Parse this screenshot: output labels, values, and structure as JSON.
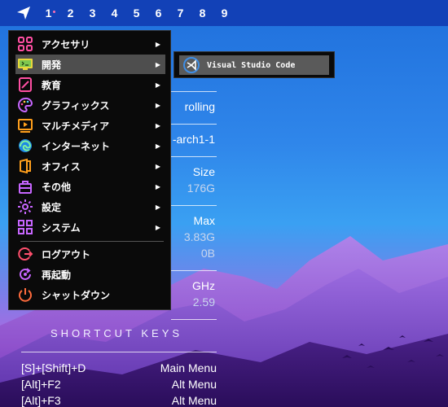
{
  "topbar": {
    "workspaces": [
      "1",
      "2",
      "3",
      "4",
      "5",
      "6",
      "7",
      "8",
      "9"
    ],
    "active_workspace": "1"
  },
  "menu": {
    "items": [
      {
        "label": "アクセサリ",
        "icon": "accessories-icon",
        "submenu": true
      },
      {
        "label": "開発",
        "icon": "development-icon",
        "submenu": true
      },
      {
        "label": "教育",
        "icon": "education-icon",
        "submenu": true
      },
      {
        "label": "グラフィックス",
        "icon": "graphics-icon",
        "submenu": true
      },
      {
        "label": "マルチメディア",
        "icon": "multimedia-icon",
        "submenu": true
      },
      {
        "label": "インターネット",
        "icon": "internet-icon",
        "submenu": true
      },
      {
        "label": "オフィス",
        "icon": "office-icon",
        "submenu": true
      },
      {
        "label": "その他",
        "icon": "other-icon",
        "submenu": true
      },
      {
        "label": "設定",
        "icon": "settings-icon",
        "submenu": true
      },
      {
        "label": "システム",
        "icon": "system-icon",
        "submenu": true
      },
      {
        "label": "ログアウト",
        "icon": "logout-icon",
        "submenu": false
      },
      {
        "label": "再起動",
        "icon": "reboot-icon",
        "submenu": false
      },
      {
        "label": "シャットダウン",
        "icon": "shutdown-icon",
        "submenu": false
      }
    ],
    "selected": "開発"
  },
  "submenu": {
    "items": [
      {
        "label": "Visual Studio Code",
        "icon": "vscode-icon"
      }
    ]
  },
  "conky": {
    "release": "rolling",
    "kernel": "-arch1-1",
    "disk_header": "Size",
    "disk_value": "176G",
    "mem_header": "Max",
    "mem_value": "3.83G",
    "swap_value": "0B",
    "cpu_header": "GHz",
    "cpu_value": "2.59",
    "shortcuts_title": "SHORTCUT KEYS",
    "shortcuts": [
      {
        "keys": "[S]+[Shift]+D",
        "action": "Main Menu"
      },
      {
        "keys": "[Alt]+F2",
        "action": "Alt Menu"
      },
      {
        "keys": "[Alt]+F3",
        "action": "Alt Menu"
      }
    ]
  },
  "colors": {
    "panel": "#1241b7",
    "menu_bg": "#0a0a0a",
    "menu_selected": "#4e4e4e",
    "icon_accent": "#ff4fa3"
  }
}
